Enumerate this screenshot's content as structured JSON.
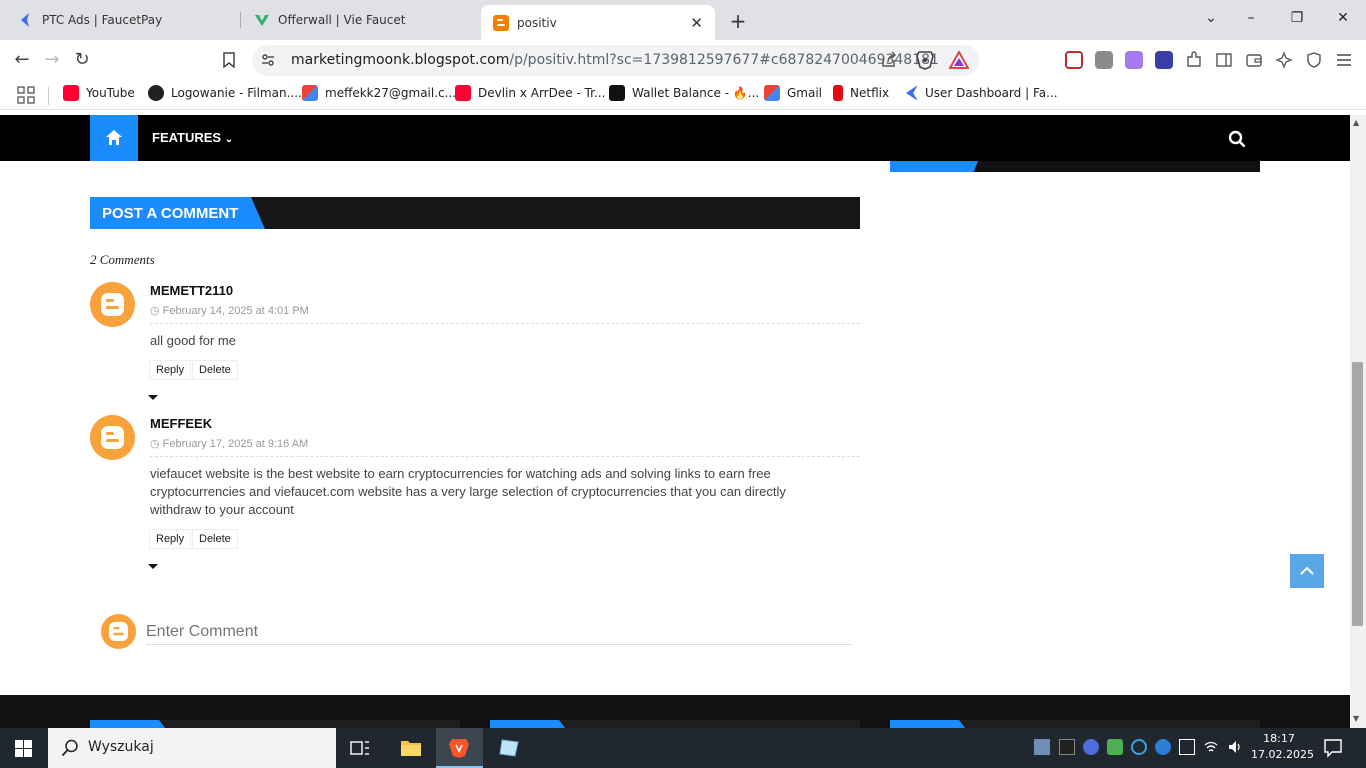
{
  "tabs": [
    {
      "title": "PTC Ads | FaucetPay"
    },
    {
      "title": "Offerwall | Vie Faucet"
    },
    {
      "title": "positiv"
    }
  ],
  "address": {
    "host": "marketingmoonk.blogspot.com",
    "path": "/p/positiv.html?sc=1739812597677#c687824700469348181"
  },
  "bookmarks": [
    {
      "label": "YouTube"
    },
    {
      "label": "Logowanie - Filman...."
    },
    {
      "label": "meffekk27@gmail.c..."
    },
    {
      "label": "Devlin x ArrDee - Tr..."
    },
    {
      "label": "Wallet Balance - 🔥..."
    },
    {
      "label": "Gmail"
    },
    {
      "label": "Netflix"
    },
    {
      "label": "User Dashboard | Fa..."
    }
  ],
  "nav": {
    "features_label": "FEATURES"
  },
  "post_comment_heading": "POST A COMMENT",
  "comment_count": "2 Comments",
  "comments": [
    {
      "author": "MEMETT2110",
      "date": "February 14, 2025 at 4:01 PM",
      "text": "all good for me",
      "reply": "Reply",
      "delete": "Delete"
    },
    {
      "author": "MEFFEEK",
      "date": "February 17, 2025 at 9:16 AM",
      "text": "viefaucet website is the best website to earn cryptocurrencies for watching ads and solving links to earn free cryptocurrencies and viefaucet.com website has a very large selection of cryptocurrencies that you can directly withdraw to your account",
      "reply": "Reply",
      "delete": "Delete"
    }
  ],
  "comment_input": {
    "placeholder": "Enter Comment"
  },
  "taskbar": {
    "search_placeholder": "Wyszukaj",
    "time": "18:17",
    "date": "17.02.2025"
  },
  "colors": {
    "accent": "#1a8cff",
    "blogger_orange": "#f7a23a"
  }
}
